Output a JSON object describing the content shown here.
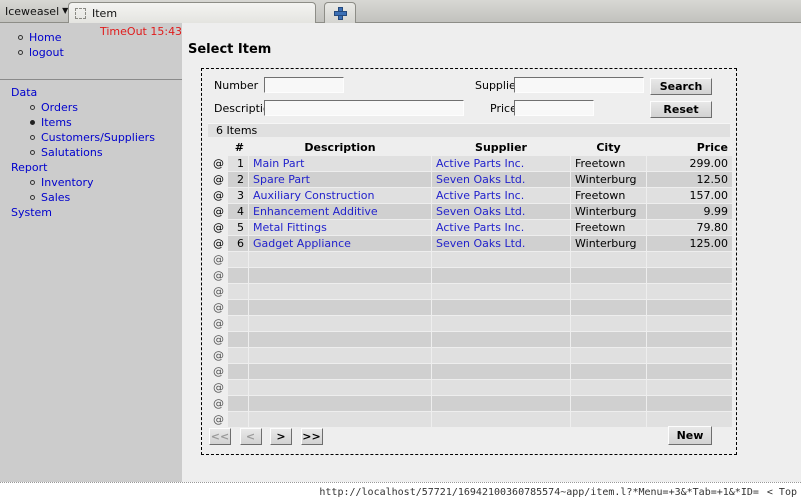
{
  "browser": {
    "app_menu_label": "Iceweasel",
    "app_menu_caret": "▼",
    "tab_title": "Item",
    "newtab_title": "+"
  },
  "sidebar": {
    "timeout_label": "TimeOut 15:43",
    "top_links": [
      {
        "label": "Home",
        "current": false
      },
      {
        "label": "logout",
        "current": false
      }
    ],
    "groups": [
      {
        "label": "Data",
        "items": [
          {
            "label": "Orders",
            "current": false
          },
          {
            "label": "Items",
            "current": true
          },
          {
            "label": "Customers/Suppliers",
            "current": false
          },
          {
            "label": "Salutations",
            "current": false
          }
        ]
      },
      {
        "label": "Report",
        "items": [
          {
            "label": "Inventory",
            "current": false
          },
          {
            "label": "Sales",
            "current": false
          }
        ]
      },
      {
        "label": "System",
        "items": []
      }
    ]
  },
  "main": {
    "page_title": "Select Item",
    "search": {
      "number_label": "Number",
      "number_value": "",
      "description_label": "Description",
      "description_value": "",
      "supplier_label": "Supplier",
      "supplier_value": "",
      "price_label": "Price",
      "price_value": "",
      "search_button": "Search",
      "reset_button": "Reset"
    },
    "results": {
      "count_label": "6 Items",
      "row_icon": "@",
      "columns": [
        "#",
        "Description",
        "Supplier",
        "City",
        "Price"
      ],
      "rows": [
        {
          "num": "1",
          "description": "Main Part",
          "supplier": "Active Parts Inc.",
          "city": "Freetown",
          "price": "299.00"
        },
        {
          "num": "2",
          "description": "Spare Part",
          "supplier": "Seven Oaks Ltd.",
          "city": "Winterburg",
          "price": "12.50"
        },
        {
          "num": "3",
          "description": "Auxiliary Construction",
          "supplier": "Active Parts Inc.",
          "city": "Freetown",
          "price": "157.00"
        },
        {
          "num": "4",
          "description": "Enhancement Additive",
          "supplier": "Seven Oaks Ltd.",
          "city": "Winterburg",
          "price": "9.99"
        },
        {
          "num": "5",
          "description": "Metal Fittings",
          "supplier": "Active Parts Inc.",
          "city": "Freetown",
          "price": "79.80"
        },
        {
          "num": "6",
          "description": "Gadget Appliance",
          "supplier": "Seven Oaks Ltd.",
          "city": "Winterburg",
          "price": "125.00"
        }
      ],
      "empty_row_count": 11
    },
    "footer": {
      "first_label": "<<",
      "prev_label": "<",
      "next_label": ">",
      "last_label": ">>",
      "first_disabled": true,
      "prev_disabled": true,
      "next_disabled": false,
      "last_disabled": false,
      "new_button": "New"
    }
  },
  "status": {
    "url": "http://localhost/57721/16942100360785574~app/item.l?*Menu=+3&*Tab=+1&*ID=",
    "top_link": "< Top"
  },
  "colors": {
    "link": "#2222cc",
    "nav_link": "#0000cc",
    "timeout": "#e01b1b",
    "sidebar_bg": "#cccccc",
    "content_bg": "#eeeeee",
    "row_odd": "#e0e0e0",
    "row_even": "#d0d0d0"
  }
}
